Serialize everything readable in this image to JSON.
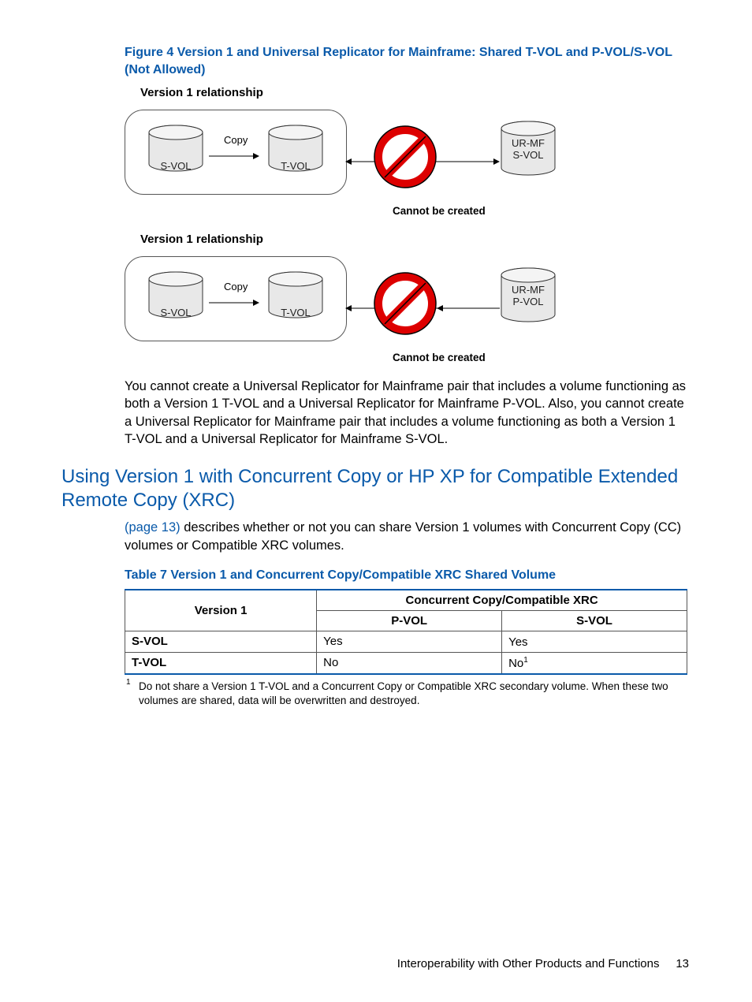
{
  "figure": {
    "caption": "Figure 4 Version 1 and Universal Replicator for Mainframe: Shared T-VOL and P-VOL/S-VOL (Not Allowed)",
    "relationship_title": "Version 1 relationship",
    "svol": "S-VOL",
    "tvol": "T-VOL",
    "copy": "Copy",
    "cannot": "Cannot be created",
    "urmf": "UR-MF",
    "urmf_svol": "S-VOL",
    "urmf_pvol": "P-VOL"
  },
  "paragraphs": {
    "p1": "You cannot create a Universal Replicator for Mainframe pair that includes a volume functioning as both a Version 1 T-VOL and a Universal Replicator for Mainframe P-VOL. Also, you cannot create a Universal Replicator for Mainframe pair that includes a volume functioning as both a Version 1 T-VOL and a Universal Replicator for Mainframe S-VOL."
  },
  "heading": "Using Version 1 with Concurrent Copy or HP XP for Compatible Extended Remote Copy (XRC)",
  "para2": {
    "link": "(page 13)",
    "rest": " describes whether or not you can share Version 1 volumes with Concurrent Copy (CC) volumes or Compatible XRC volumes."
  },
  "table": {
    "caption": "Table 7 Version 1 and Concurrent Copy/Compatible XRC Shared Volume",
    "col_v1": "Version 1",
    "col_cc": "Concurrent Copy/Compatible XRC",
    "sub_pvol": "P-VOL",
    "sub_svol": "S-VOL",
    "rows": [
      {
        "label": "S-VOL",
        "pvol": "Yes",
        "svol": "Yes",
        "svol_note": ""
      },
      {
        "label": "T-VOL",
        "pvol": "No",
        "svol": "No",
        "svol_note": "1"
      }
    ],
    "footnote_num": "1",
    "footnote": "Do not share a Version 1 T-VOL and a Concurrent Copy or Compatible XRC secondary volume. When these two volumes are shared, data will be overwritten and destroyed."
  },
  "footer": {
    "section": "Interoperability with Other Products and Functions",
    "page": "13"
  }
}
